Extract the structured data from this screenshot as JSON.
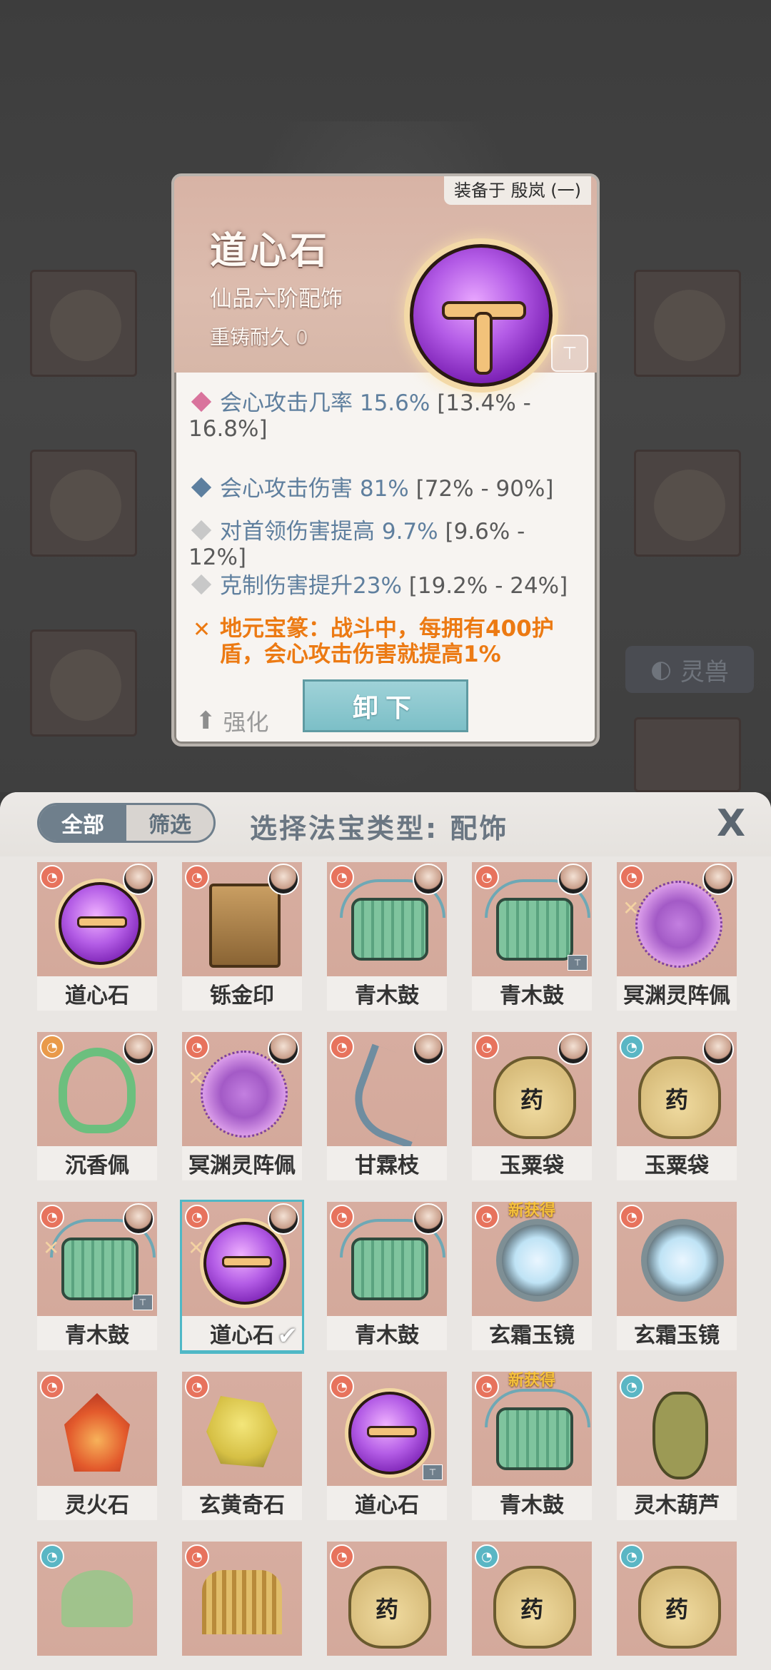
{
  "background": {
    "lingshou_label": "灵兽"
  },
  "card": {
    "equipped_label": "装备于 殷岚 (一)",
    "item_name": "道心石",
    "grade": "仙品六阶配饰",
    "durability_label": "重铸耐久",
    "durability_value": "0",
    "stats": [
      {
        "name_value": "会心攻击几率 15.6%",
        "range": " [13.4% - 16.8%]",
        "diamond_color": "#d9739c"
      },
      {
        "name_value": "会心攻击伤害 81%",
        "range": " [72% - 90%]",
        "diamond_color": "#5d7f9f"
      },
      {
        "name_value": "对首领伤害提高 9.7%",
        "range": " [9.6% - 12%]",
        "diamond_color": "#c8c8c8"
      },
      {
        "name_value": "克制伤害提升23%",
        "range": " [19.2% - 24%]",
        "diamond_color": "#c8c8c8"
      }
    ],
    "set_effect": "地元宝篆：战斗中，每拥有400护盾，会心攻击伤害就提高1%",
    "upgrade_label": "强化",
    "unequip_label": "卸下"
  },
  "panel": {
    "tabs": [
      {
        "label": "全部",
        "active": true
      },
      {
        "label": "筛选",
        "active": false
      }
    ],
    "title": "选择法宝类型: 配饰",
    "close_icon": "close-icon",
    "new_badge": "新获得",
    "items": [
      {
        "label": "道心石",
        "art": "orb",
        "rank": "red"
      },
      {
        "label": "铄金印",
        "art": "seal",
        "rank": "red"
      },
      {
        "label": "青木鼓",
        "art": "drum",
        "rank": "red"
      },
      {
        "label": "青木鼓",
        "art": "drum",
        "rank": "red",
        "locked": true
      },
      {
        "label": "冥渊灵阵佩",
        "art": "web",
        "rank": "red",
        "set": true
      },
      {
        "label": "沉香佩",
        "art": "beads",
        "rank": "orange"
      },
      {
        "label": "冥渊灵阵佩",
        "art": "web",
        "rank": "red",
        "set": true
      },
      {
        "label": "甘霖枝",
        "art": "branch",
        "rank": "red"
      },
      {
        "label": "玉粟袋",
        "art": "sack",
        "rank": "red"
      },
      {
        "label": "玉粟袋",
        "art": "sack",
        "rank": "blue"
      },
      {
        "label": "青木鼓",
        "art": "drum",
        "rank": "red",
        "set": true,
        "locked": true
      },
      {
        "label": "道心石",
        "art": "orb",
        "rank": "red",
        "set": true,
        "selected": true
      },
      {
        "label": "青木鼓",
        "art": "drum",
        "rank": "red"
      },
      {
        "label": "玄霜玉镜",
        "art": "mirror",
        "rank": "red",
        "new": true
      },
      {
        "label": "玄霜玉镜",
        "art": "mirror",
        "rank": "red"
      },
      {
        "label": "灵火石",
        "art": "firestone",
        "rank": "red"
      },
      {
        "label": "玄黄奇石",
        "art": "yellowrock",
        "rank": "red"
      },
      {
        "label": "道心石",
        "art": "orb",
        "rank": "red",
        "locked": true
      },
      {
        "label": "青木鼓",
        "art": "drum",
        "rank": "red",
        "new": true
      },
      {
        "label": "灵木葫芦",
        "art": "gourd",
        "rank": "blue"
      },
      {
        "label": "",
        "art": "partial",
        "rank": "blue"
      },
      {
        "label": "",
        "art": "coil",
        "rank": "red"
      },
      {
        "label": "",
        "art": "sack",
        "rank": "red"
      },
      {
        "label": "",
        "art": "sack",
        "rank": "blue"
      },
      {
        "label": "",
        "art": "sack",
        "rank": "blue"
      }
    ]
  }
}
